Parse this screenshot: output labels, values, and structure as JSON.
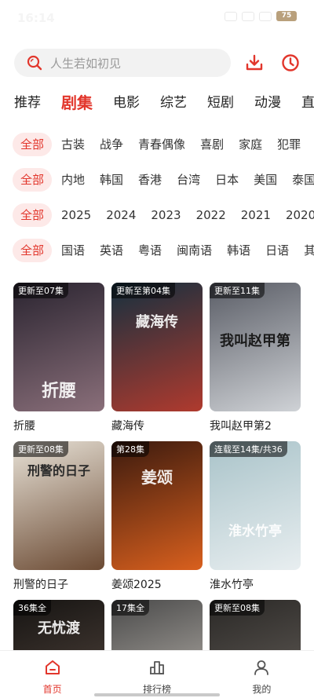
{
  "status": {
    "time": "16:14",
    "battery": "75"
  },
  "search": {
    "placeholder": "人生若如初见"
  },
  "main_tabs": [
    "推荐",
    "剧集",
    "电影",
    "综艺",
    "短剧",
    "动漫",
    "直"
  ],
  "filters": {
    "genre": [
      "全部",
      "古装",
      "战争",
      "青春偶像",
      "喜剧",
      "家庭",
      "犯罪"
    ],
    "region": [
      "全部",
      "内地",
      "韩国",
      "香港",
      "台湾",
      "日本",
      "美国",
      "泰国"
    ],
    "year": [
      "全部",
      "2025",
      "2024",
      "2023",
      "2022",
      "2021",
      "2020"
    ],
    "language": [
      "全部",
      "国语",
      "英语",
      "粤语",
      "闽南语",
      "韩语",
      "日语",
      "其"
    ]
  },
  "cards": [
    {
      "title": "折腰",
      "badge": "更新至07集",
      "poster_text": "折腰",
      "color_a": "#2a2430",
      "color_b": "#8a6f7a"
    },
    {
      "title": "藏海传",
      "badge": "更新至第04集",
      "poster_text": "藏海传",
      "color_a": "#15303f",
      "color_b": "#b03a2e"
    },
    {
      "title": "我叫赵甲第2",
      "badge": "更新至11集",
      "poster_text": "我叫赵甲第",
      "color_a": "#5a5d66",
      "color_b": "#cfd2d6"
    },
    {
      "title": "刑警的日子",
      "badge": "更新至08集",
      "poster_text": "刑警的日子",
      "color_a": "#e7e1d6",
      "color_b": "#6b4a33"
    },
    {
      "title": "姜颂2025",
      "badge": "第28集",
      "poster_text": "姜颂",
      "color_a": "#3b1a0e",
      "color_b": "#d9601e"
    },
    {
      "title": "淮水竹亭",
      "badge": "连载至14集/共36",
      "poster_text": "淮水竹亭",
      "color_a": "#a9c3c9",
      "color_b": "#e8eef0"
    },
    {
      "title": "",
      "badge": "36集全",
      "poster_text": "无忧渡",
      "color_a": "#161412",
      "color_b": "#5b4c44"
    },
    {
      "title": "",
      "badge": "17集全",
      "poster_text": "",
      "color_a": "#4a4a4a",
      "color_b": "#c9c3bb"
    },
    {
      "title": "",
      "badge": "更新至08集",
      "poster_text": "",
      "color_a": "#2a2826",
      "color_b": "#6d6761"
    }
  ],
  "bottom_nav": [
    {
      "label": "首页",
      "icon": "home-icon"
    },
    {
      "label": "排行榜",
      "icon": "ranking-icon"
    },
    {
      "label": "我的",
      "icon": "user-icon"
    }
  ],
  "accent": "#e2362c"
}
